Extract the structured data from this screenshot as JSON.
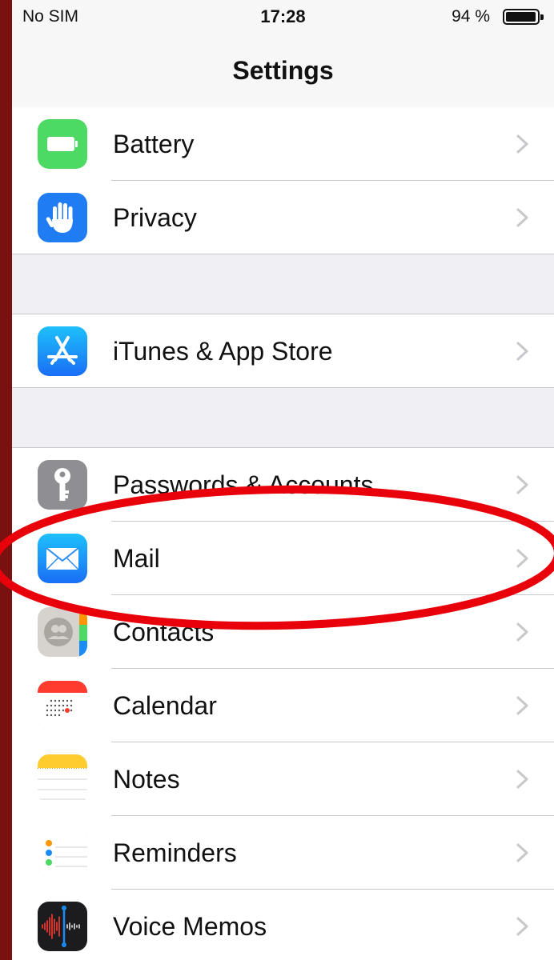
{
  "status_bar": {
    "carrier": "No SIM",
    "time": "17:28",
    "battery_text": "94 %",
    "battery_level": 0.94
  },
  "nav": {
    "title": "Settings"
  },
  "rows": [
    {
      "label": "Battery",
      "icon": "battery-icon",
      "icon_color": "#4cd964"
    },
    {
      "label": "Privacy",
      "icon": "hand-icon",
      "icon_color": "#1f7cf2"
    },
    {
      "label": "iTunes & App Store",
      "icon": "app-store-icon",
      "icon_color": "#1a8cf8"
    },
    {
      "label": "Passwords & Accounts",
      "icon": "key-icon",
      "icon_color": "#8e8e93"
    },
    {
      "label": "Mail",
      "icon": "mail-icon",
      "icon_color": "#1a8cf8"
    },
    {
      "label": "Contacts",
      "icon": "contacts-icon",
      "icon_color": "#b4b2ad"
    },
    {
      "label": "Calendar",
      "icon": "calendar-icon",
      "icon_color": "#ff3b30"
    },
    {
      "label": "Notes",
      "icon": "notes-icon",
      "icon_color": "#fecc2f"
    },
    {
      "label": "Reminders",
      "icon": "reminders-icon",
      "icon_color": "#ffffff"
    },
    {
      "label": "Voice Memos",
      "icon": "voice-memos-icon",
      "icon_color": "#1c1c1e"
    }
  ],
  "annotation": {
    "color": "#e8000b",
    "target": "Mail"
  }
}
